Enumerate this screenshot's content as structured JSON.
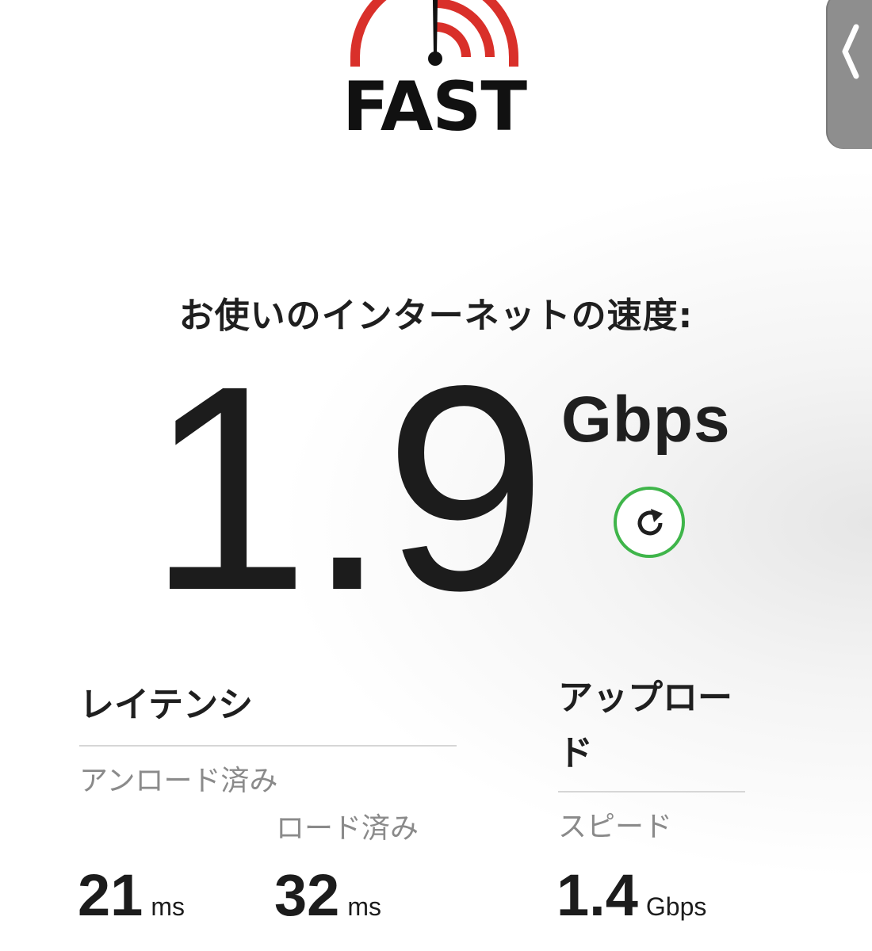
{
  "logo": {
    "wordmark": "FAST",
    "accent_color": "#d9302a"
  },
  "side_panel": {
    "icon": "chevron-left-icon"
  },
  "headline": "お使いのインターネットの速度:",
  "speed": {
    "value": "1.9",
    "unit": "Gbps",
    "reload_icon": "reload-icon",
    "reload_color": "#3fb54a"
  },
  "latency": {
    "title": "レイテンシ",
    "unloaded_label": "アンロード済み",
    "unloaded_value": "21",
    "unloaded_unit": "ms",
    "loaded_label": "ロード済み",
    "loaded_value": "32",
    "loaded_unit": "ms"
  },
  "upload": {
    "title": "アップロード",
    "speed_label": "スピード",
    "speed_value": "1.4",
    "speed_unit": "Gbps"
  }
}
